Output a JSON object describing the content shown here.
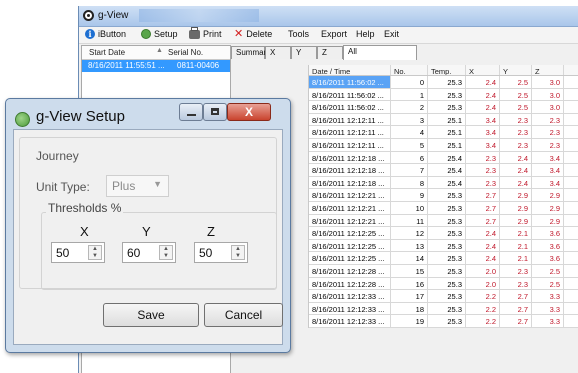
{
  "main_window": {
    "title": "g-View",
    "menu": {
      "ibutton": "iButton",
      "setup": "Setup",
      "print": "Print",
      "delete": "Delete",
      "tools": "Tools",
      "export": "Export",
      "help": "Help",
      "exit": "Exit"
    },
    "icons": {
      "app": "gview-app-icon",
      "ibutton": "info-icon",
      "setup": "setup-icon",
      "print": "printer-icon",
      "delete": "delete-x-icon"
    },
    "device_list": {
      "headers": {
        "start_date": "Start Date",
        "serial": "Serial No."
      },
      "rows": [
        {
          "start_date": "8/16/2011 11:55:51 ...",
          "serial": "0811-00406"
        }
      ]
    },
    "tabs": [
      "Summary",
      "X",
      "Y",
      "Z",
      "All"
    ],
    "active_tab": "All",
    "grid": {
      "headers": [
        "Date / Time",
        "No.",
        "Temp.",
        "X",
        "Y",
        "Z"
      ],
      "rows": [
        [
          "8/16/2011 11:56:02 ...",
          "0",
          "25.3",
          "2.4",
          "2.5",
          "3.0"
        ],
        [
          "8/16/2011 11:56:02 ...",
          "1",
          "25.3",
          "2.4",
          "2.5",
          "3.0"
        ],
        [
          "8/16/2011 11:56:02 ...",
          "2",
          "25.3",
          "2.4",
          "2.5",
          "3.0"
        ],
        [
          "8/16/2011 12:12:11 ...",
          "3",
          "25.1",
          "3.4",
          "2.3",
          "2.3"
        ],
        [
          "8/16/2011 12:12:11 ...",
          "4",
          "25.1",
          "3.4",
          "2.3",
          "2.3"
        ],
        [
          "8/16/2011 12:12:11 ...",
          "5",
          "25.1",
          "3.4",
          "2.3",
          "2.3"
        ],
        [
          "8/16/2011 12:12:18 ...",
          "6",
          "25.4",
          "2.3",
          "2.4",
          "3.4"
        ],
        [
          "8/16/2011 12:12:18 ...",
          "7",
          "25.4",
          "2.3",
          "2.4",
          "3.4"
        ],
        [
          "8/16/2011 12:12:18 ...",
          "8",
          "25.4",
          "2.3",
          "2.4",
          "3.4"
        ],
        [
          "8/16/2011 12:12:21 ...",
          "9",
          "25.3",
          "2.7",
          "2.9",
          "2.9"
        ],
        [
          "8/16/2011 12:12:21 ...",
          "10",
          "25.3",
          "2.7",
          "2.9",
          "2.9"
        ],
        [
          "8/16/2011 12:12:21 ...",
          "11",
          "25.3",
          "2.7",
          "2.9",
          "2.9"
        ],
        [
          "8/16/2011 12:12:25 ...",
          "12",
          "25.3",
          "2.4",
          "2.1",
          "3.6"
        ],
        [
          "8/16/2011 12:12:25 ...",
          "13",
          "25.3",
          "2.4",
          "2.1",
          "3.6"
        ],
        [
          "8/16/2011 12:12:25 ...",
          "14",
          "25.3",
          "2.4",
          "2.1",
          "3.6"
        ],
        [
          "8/16/2011 12:12:28 ...",
          "15",
          "25.3",
          "2.0",
          "2.3",
          "2.5"
        ],
        [
          "8/16/2011 12:12:28 ...",
          "16",
          "25.3",
          "2.0",
          "2.3",
          "2.5"
        ],
        [
          "8/16/2011 12:12:33 ...",
          "17",
          "25.3",
          "2.2",
          "2.7",
          "3.3"
        ],
        [
          "8/16/2011 12:12:33 ...",
          "18",
          "25.3",
          "2.2",
          "2.7",
          "3.3"
        ],
        [
          "8/16/2011 12:12:33 ...",
          "19",
          "25.3",
          "2.2",
          "2.7",
          "3.3"
        ]
      ]
    }
  },
  "setup_dialog": {
    "title": "g-View Setup",
    "journey_label": "Journey",
    "unit_type_label": "Unit Type:",
    "unit_type_value": "Plus",
    "thresholds_label": "Thresholds %",
    "axes": {
      "x": "X",
      "y": "Y",
      "z": "Z"
    },
    "values": {
      "x": "50",
      "y": "60",
      "z": "50"
    },
    "save_label": "Save",
    "cancel_label": "Cancel",
    "close_glyph": "X"
  },
  "colors": {
    "selection_blue": "#3399ff",
    "axis_value_red": "#c0182b",
    "close_button_red": "#c9432e",
    "dialog_frame": "#cddcec"
  }
}
